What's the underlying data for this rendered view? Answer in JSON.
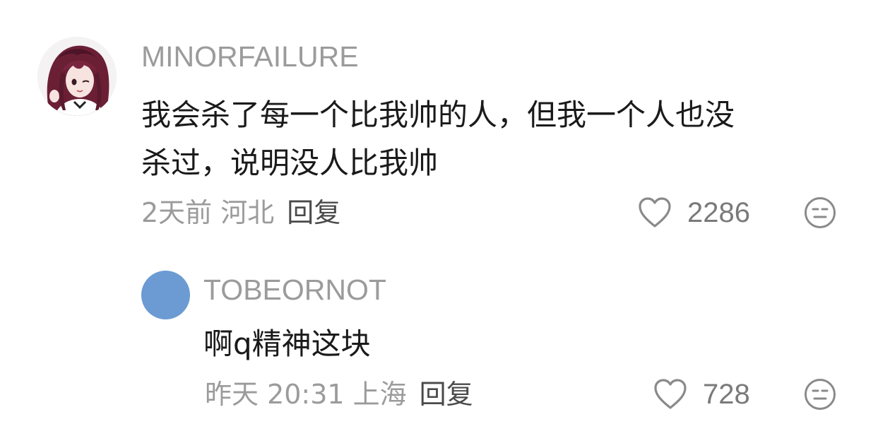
{
  "colors": {
    "username": "#9b9b9b",
    "body_text": "#1a1a1a",
    "meta_text": "#9b9b9b",
    "reply_link": "#4a4a4a",
    "icon_stroke": "#8a8a8a",
    "reply_avatar": "#6b9bd2"
  },
  "comments": [
    {
      "username": "MINORFAILURE",
      "text_line1": "我会杀了每一个比我帅的人，但我一个人也没",
      "text_line2": "杀过，说明没人比我帅",
      "meta": "2天前 河北",
      "reply_label": "回复",
      "likes": "2286",
      "avatar_icon": "anime-avatar-icon",
      "like_icon": "heart-outline-icon",
      "emoji_icon": "neutral-face-icon"
    },
    {
      "username": "TOBEORNOT",
      "text": "啊q精神这块",
      "meta": "昨天 20:31 上海",
      "reply_label": "回复",
      "likes": "728",
      "avatar_icon": "blue-circle-avatar",
      "like_icon": "heart-outline-icon",
      "emoji_icon": "neutral-face-icon"
    }
  ]
}
